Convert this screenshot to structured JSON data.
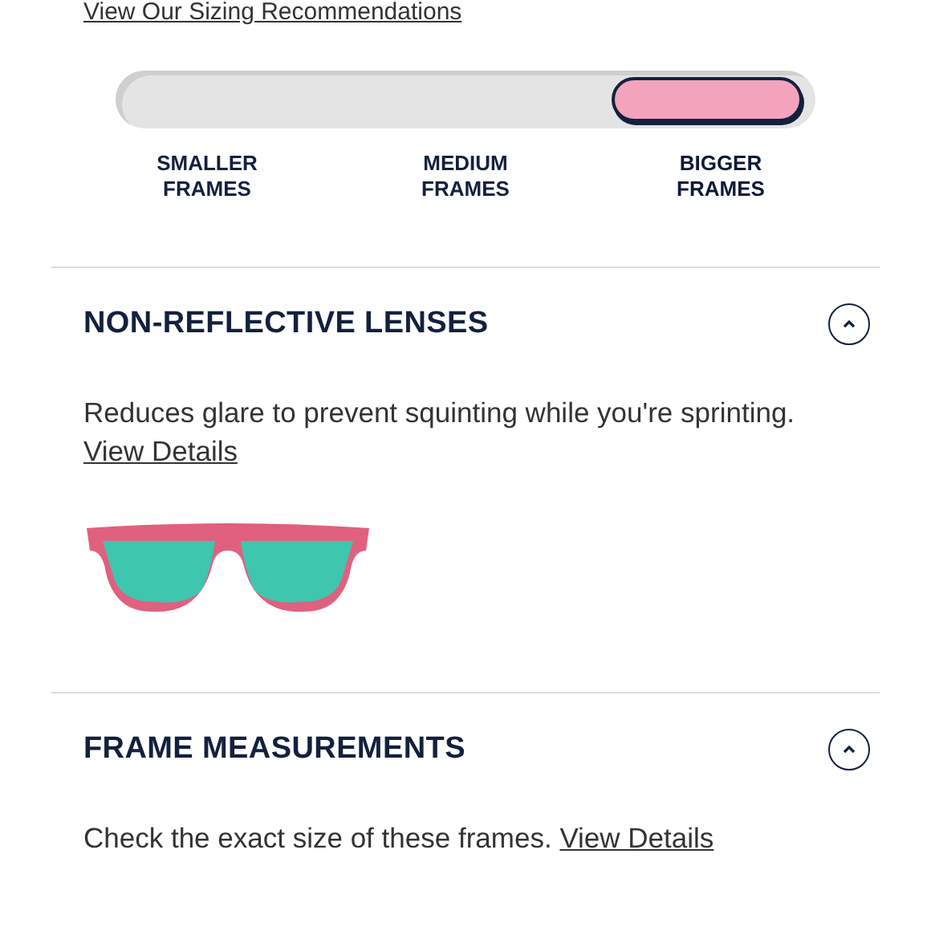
{
  "sizing_link": "View Our Sizing Recommendations",
  "size_scale": {
    "options": [
      {
        "label": "SMALLER FRAMES",
        "selected": false
      },
      {
        "label": "MEDIUM FRAMES",
        "selected": false
      },
      {
        "label": "BIGGER FRAMES",
        "selected": true
      }
    ]
  },
  "sections": [
    {
      "title": "NON-REFLECTIVE LENSES",
      "expanded": true,
      "description": "Reduces glare to prevent squinting while you're sprinting.",
      "link": "View Details",
      "kind": "illustrated"
    },
    {
      "title": "FRAME MEASUREMENTS",
      "expanded": true,
      "description": "Check the exact size of these frames.",
      "link": "View Details",
      "kind": "plain"
    }
  ]
}
